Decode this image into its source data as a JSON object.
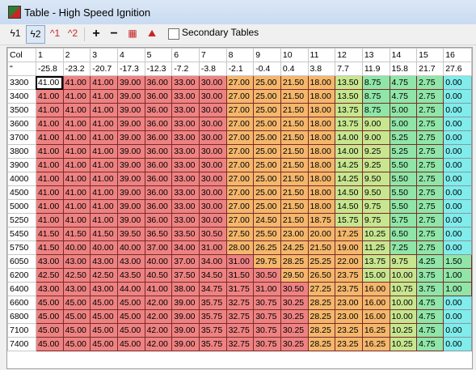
{
  "window": {
    "title": "Table - High Speed Ignition"
  },
  "toolbar": {
    "items": [
      {
        "name": "ignition-1-button",
        "text": "ϟ1",
        "active": false
      },
      {
        "name": "ignition-2-button",
        "text": "ϟ2",
        "active": true
      },
      {
        "name": "ignition-mark-1-button",
        "text": "^1",
        "active": false
      },
      {
        "name": "ignition-mark-2-button",
        "text": "^2",
        "active": false
      },
      {
        "name": "add-button",
        "text": "+",
        "active": false
      },
      {
        "name": "subtract-button",
        "text": "−",
        "active": false
      },
      {
        "name": "3d-view-button",
        "text": "▦",
        "active": false
      },
      {
        "name": "graph-button",
        "text": "⛰",
        "active": false
      }
    ],
    "secondary_tables_label": "Secondary Tables",
    "secondary_tables_checked": false
  },
  "grid": {
    "corner_label": "Col",
    "unit_label": "\"",
    "columns": [
      "1",
      "2",
      "3",
      "4",
      "5",
      "6",
      "7",
      "8",
      "9",
      "10",
      "11",
      "12",
      "13",
      "14",
      "15",
      "16"
    ],
    "column_values": [
      "-25.8",
      "-23.2",
      "-20.7",
      "-17.3",
      "-12.3",
      "-7.2",
      "-3.8",
      "-2.1",
      "-0.4",
      "0.4",
      "3.8",
      "7.7",
      "11.9",
      "15.8",
      "21.7",
      "27.6"
    ],
    "rows": [
      {
        "rpm": "3300",
        "values": [
          "41.00",
          "41.00",
          "41.00",
          "39.00",
          "36.00",
          "33.00",
          "30.00",
          "27.00",
          "25.00",
          "21.50",
          "18.00",
          "13.50",
          "8.75",
          "4.75",
          "2.75",
          "0.00"
        ]
      },
      {
        "rpm": "3400",
        "values": [
          "41.00",
          "41.00",
          "41.00",
          "39.00",
          "36.00",
          "33.00",
          "30.00",
          "27.00",
          "25.00",
          "21.50",
          "18.00",
          "13.50",
          "8.75",
          "4.75",
          "2.75",
          "0.00"
        ]
      },
      {
        "rpm": "3500",
        "values": [
          "41.00",
          "41.00",
          "41.00",
          "39.00",
          "36.00",
          "33.00",
          "30.00",
          "27.00",
          "25.00",
          "21.50",
          "18.00",
          "13.75",
          "8.75",
          "5.00",
          "2.75",
          "0.00"
        ]
      },
      {
        "rpm": "3600",
        "values": [
          "41.00",
          "41.00",
          "41.00",
          "39.00",
          "36.00",
          "33.00",
          "30.00",
          "27.00",
          "25.00",
          "21.50",
          "18.00",
          "13.75",
          "9.00",
          "5.00",
          "2.75",
          "0.00"
        ]
      },
      {
        "rpm": "3700",
        "values": [
          "41.00",
          "41.00",
          "41.00",
          "39.00",
          "36.00",
          "33.00",
          "30.00",
          "27.00",
          "25.00",
          "21.50",
          "18.00",
          "14.00",
          "9.00",
          "5.25",
          "2.75",
          "0.00"
        ]
      },
      {
        "rpm": "3800",
        "values": [
          "41.00",
          "41.00",
          "41.00",
          "39.00",
          "36.00",
          "33.00",
          "30.00",
          "27.00",
          "25.00",
          "21.50",
          "18.00",
          "14.00",
          "9.25",
          "5.25",
          "2.75",
          "0.00"
        ]
      },
      {
        "rpm": "3900",
        "values": [
          "41.00",
          "41.00",
          "41.00",
          "39.00",
          "36.00",
          "33.00",
          "30.00",
          "27.00",
          "25.00",
          "21.50",
          "18.00",
          "14.25",
          "9.25",
          "5.50",
          "2.75",
          "0.00"
        ]
      },
      {
        "rpm": "4000",
        "values": [
          "41.00",
          "41.00",
          "41.00",
          "39.00",
          "36.00",
          "33.00",
          "30.00",
          "27.00",
          "25.00",
          "21.50",
          "18.00",
          "14.25",
          "9.50",
          "5.50",
          "2.75",
          "0.00"
        ]
      },
      {
        "rpm": "4500",
        "values": [
          "41.00",
          "41.00",
          "41.00",
          "39.00",
          "36.00",
          "33.00",
          "30.00",
          "27.00",
          "25.00",
          "21.50",
          "18.00",
          "14.50",
          "9.50",
          "5.50",
          "2.75",
          "0.00"
        ]
      },
      {
        "rpm": "5000",
        "values": [
          "41.00",
          "41.00",
          "41.00",
          "39.00",
          "36.00",
          "33.00",
          "30.00",
          "27.00",
          "25.00",
          "21.50",
          "18.00",
          "14.50",
          "9.75",
          "5.50",
          "2.75",
          "0.00"
        ]
      },
      {
        "rpm": "5250",
        "values": [
          "41.00",
          "41.00",
          "41.00",
          "39.00",
          "36.00",
          "33.00",
          "30.00",
          "27.00",
          "24.50",
          "21.50",
          "18.75",
          "15.75",
          "9.75",
          "5.75",
          "2.75",
          "0.00"
        ]
      },
      {
        "rpm": "5450",
        "values": [
          "41.50",
          "41.50",
          "41.50",
          "39.50",
          "36.50",
          "33.50",
          "30.50",
          "27.50",
          "25.50",
          "23.00",
          "20.00",
          "17.25",
          "10.25",
          "6.50",
          "2.75",
          "0.00"
        ]
      },
      {
        "rpm": "5750",
        "values": [
          "41.50",
          "40.00",
          "40.00",
          "40.00",
          "37.00",
          "34.00",
          "31.00",
          "28.00",
          "26.25",
          "24.25",
          "21.50",
          "19.00",
          "11.25",
          "7.25",
          "2.75",
          "0.00"
        ]
      },
      {
        "rpm": "6050",
        "values": [
          "43.00",
          "43.00",
          "43.00",
          "43.00",
          "40.00",
          "37.00",
          "34.00",
          "31.00",
          "29.75",
          "28.25",
          "25.25",
          "22.00",
          "13.75",
          "9.75",
          "4.25",
          "1.50"
        ]
      },
      {
        "rpm": "6200",
        "values": [
          "42.50",
          "42.50",
          "42.50",
          "43.50",
          "40.50",
          "37.50",
          "34.50",
          "31.50",
          "30.50",
          "29.50",
          "26.50",
          "23.75",
          "15.00",
          "10.00",
          "3.75",
          "1.00"
        ]
      },
      {
        "rpm": "6400",
        "values": [
          "43.00",
          "43.00",
          "43.00",
          "44.00",
          "41.00",
          "38.00",
          "34.75",
          "31.75",
          "31.00",
          "30.50",
          "27.25",
          "23.75",
          "16.00",
          "10.75",
          "3.75",
          "1.00"
        ]
      },
      {
        "rpm": "6600",
        "values": [
          "45.00",
          "45.00",
          "45.00",
          "45.00",
          "42.00",
          "39.00",
          "35.75",
          "32.75",
          "30.75",
          "30.25",
          "28.25",
          "23.00",
          "16.00",
          "10.00",
          "4.75",
          "0.00"
        ]
      },
      {
        "rpm": "6800",
        "values": [
          "45.00",
          "45.00",
          "45.00",
          "45.00",
          "42.00",
          "39.00",
          "35.75",
          "32.75",
          "30.75",
          "30.25",
          "28.25",
          "23.00",
          "16.00",
          "10.00",
          "4.75",
          "0.00"
        ]
      },
      {
        "rpm": "7100",
        "values": [
          "45.00",
          "45.00",
          "45.00",
          "45.00",
          "42.00",
          "39.00",
          "35.75",
          "32.75",
          "30.75",
          "30.25",
          "28.25",
          "23.25",
          "16.25",
          "10.25",
          "4.75",
          "0.00"
        ]
      },
      {
        "rpm": "7400",
        "values": [
          "45.00",
          "45.00",
          "45.00",
          "45.00",
          "42.00",
          "39.00",
          "35.75",
          "32.75",
          "30.75",
          "30.25",
          "28.25",
          "23.25",
          "16.25",
          "10.25",
          "4.75",
          "0.00"
        ]
      }
    ],
    "selected_cell": {
      "row": 0,
      "col": 0
    },
    "colors": {
      "high": "#ee8282",
      "mid": "#f4b76c",
      "low_mid": "#c7e68f",
      "low": "#8fe6a8",
      "zero": "#80ecec"
    }
  }
}
